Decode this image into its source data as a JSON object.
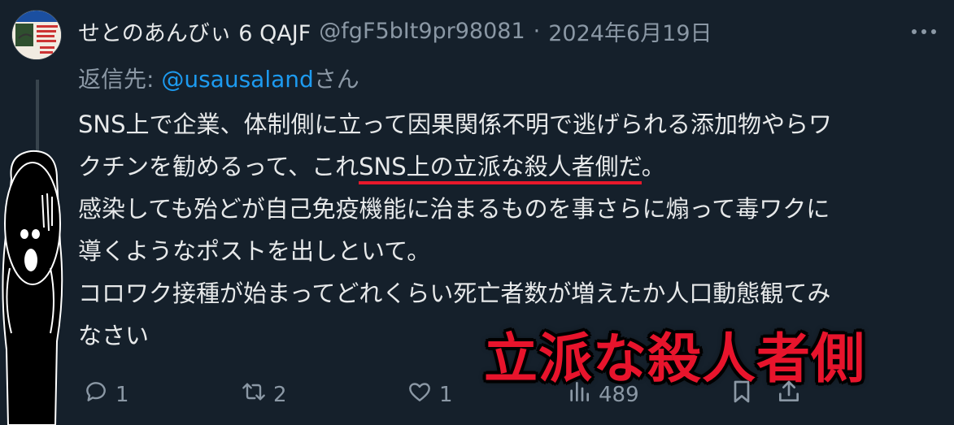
{
  "tweet": {
    "display_name": "せとのあんびぃ 6 QAJF",
    "handle": "@fgF5bIt9pr98081",
    "separator": "·",
    "date": "2024年6月19日",
    "more_label": "··",
    "reply_prefix": "返信先: ",
    "reply_mention": "@usausaland",
    "reply_suffix": "さん",
    "body": {
      "line1": "SNS上で企業、体制側に立って因果関係不明で逃げられる添加物やらワ",
      "line2_pre": "クチンを勧めるって、これ",
      "line2_underlined": "SNS上の立派な殺人者側だ",
      "line2_post": "。",
      "line3": "感染しても殆どが自己免疫機能に治まるものを事さらに煽って毒ワクに",
      "line4": "導くようなポストを出しといて。",
      "line5": "コロワク接種が始まってどれくらい死亡者数が増えたか人口動態観てみ",
      "line6": "なさい"
    }
  },
  "overlay_caption": "立派な殺人者側",
  "actions": {
    "reply_count": "1",
    "retweet_count": "2",
    "like_count": "1",
    "views_count": "489"
  },
  "icons": [
    "avatar",
    "reply-icon",
    "retweet-icon",
    "like-icon",
    "views-icon",
    "bookmark-icon",
    "share-icon",
    "more-icon"
  ],
  "colors": {
    "background": "#15202b",
    "text": "#e7e9ea",
    "muted": "#8b98a5",
    "link": "#1d9bf0",
    "underline": "#e8182b",
    "overlay": "#e8142c"
  }
}
